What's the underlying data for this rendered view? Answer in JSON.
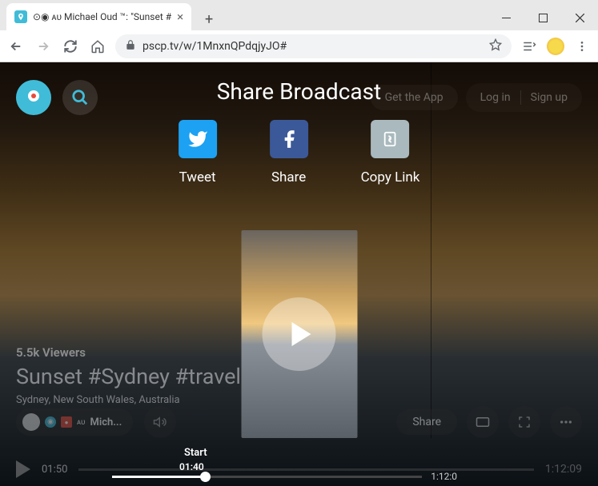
{
  "browser": {
    "tab_title": "⊙◉ ᴀᴜ Michael Oud ™: \"Sunset #",
    "url": "pscp.tv/w/1MnxnQPdqjyJO#"
  },
  "header": {
    "get_app": "Get the App",
    "login": "Log in",
    "signup": "Sign up"
  },
  "modal": {
    "title": "Share Broadcast",
    "tweet": "Tweet",
    "share": "Share",
    "copy": "Copy Link"
  },
  "broadcast": {
    "viewers": "5.5k Viewers",
    "title": "Sunset #Sydney #travel",
    "location": "Sydney, New South Wales, Australia",
    "user": "Mich...",
    "au_badge": "ᴀᴜ"
  },
  "actions": {
    "share": "Share"
  },
  "player": {
    "current": "01:50",
    "total": "1:12:09"
  },
  "slider": {
    "label": "Start",
    "value": "01:40",
    "end": "1:12:0"
  }
}
